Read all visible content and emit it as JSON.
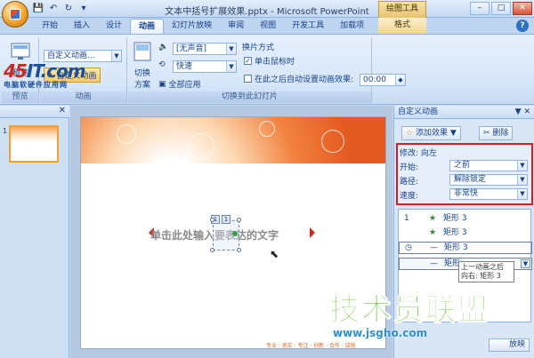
{
  "window": {
    "title": "文本中括号扩展效果.pptx - Microsoft PowerPoint",
    "context_tab": "绘图工具",
    "controls": [
      "–",
      "□",
      "✕"
    ]
  },
  "qat": [
    "💾",
    "↶",
    "↻",
    "▾"
  ],
  "tabs": [
    "开始",
    "插入",
    "设计",
    "动画",
    "幻灯片放映",
    "审阅",
    "视图",
    "开发工具",
    "加载项"
  ],
  "active_tab": "动画",
  "format_tab": "格式",
  "help": "?",
  "ribbon": {
    "preview_group": {
      "button": "预览",
      "label": "预览"
    },
    "animation_group": {
      "anim_combo": "自定义动画...",
      "custom_anim_button": "自定义动画",
      "label": "动画"
    },
    "transition_group": {
      "scheme_button_line1": "切换",
      "scheme_button_line2": "方案",
      "sound_combo": "[无声音]",
      "speed_combo": "快速",
      "apply_all": "全部应用",
      "label": "切换到此幻灯片"
    },
    "switch_group": {
      "title": "换片方式",
      "on_click": "单击鼠标时",
      "on_click_checked": true,
      "auto_after": "在此之后自动设置动画效果:",
      "auto_after_checked": false,
      "time": "00:00"
    }
  },
  "left_pane": {
    "slide_number": "1",
    "close": "✕"
  },
  "logo": {
    "brand_red": "45",
    "brand_blue": "IT",
    "brand_suffix": ".com",
    "subtitle": "电脑软硬件应用网"
  },
  "slide": {
    "text": "单击此处输入要表达的文字",
    "anim_tags": [
      "1",
      "1"
    ],
    "footer": "专业 · 务实 · 专注 · 创新 · 合作 · 成就"
  },
  "anim_pane": {
    "title": "自定义动画",
    "controls": "▼ ✕",
    "add_effect": "添加效果",
    "delete": "删除",
    "modify": "修改: 向左",
    "start_label": "开始:",
    "start_value": "之前",
    "path_label": "路径:",
    "path_value": "解除锁定",
    "speed_label": "速度:",
    "speed_value": "非常快",
    "items": [
      {
        "num": "1",
        "icon": "★",
        "label": "矩形 3"
      },
      {
        "num": "",
        "icon": "★",
        "label": "矩形 3"
      },
      {
        "num": "",
        "icon": "—",
        "label": "矩形 3"
      },
      {
        "num": "",
        "icon": "—",
        "label": "矩形"
      }
    ],
    "tooltip_line1": "上一动画之后",
    "tooltip_line2": "向右: 矩形 3",
    "bottom_button": "放映"
  },
  "watermark": {
    "title": "技术员联盟",
    "url": "www.jsgho.com"
  },
  "colors": {
    "accent_orange": "#f3a22c",
    "highlight_red": "#d71d1d",
    "watermark_green": "#3bb800",
    "watermark_blue": "#2f8fd0"
  }
}
